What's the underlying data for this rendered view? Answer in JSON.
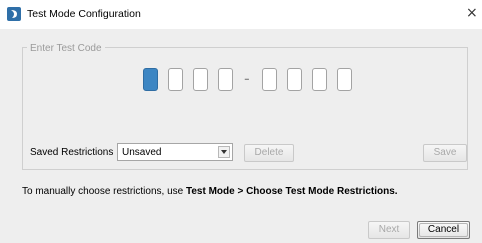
{
  "window": {
    "title": "Test Mode Configuration",
    "close_symbol": "×",
    "icon": "app-icon"
  },
  "code_group": {
    "legend": "Enter Test Code",
    "separator": "-",
    "box_count": 8,
    "active_index": 0
  },
  "restrictions": {
    "label": "Saved Restrictions",
    "selected": "Unsaved",
    "delete_label": "Delete",
    "save_label": "Save"
  },
  "instruction": {
    "prefix": "To manually choose restrictions, use ",
    "bold": "Test Mode > Choose Test Mode Restrictions."
  },
  "footer": {
    "next_label": "Next",
    "cancel_label": "Cancel"
  },
  "colors": {
    "accent": "#3d86c3",
    "dialog_bg": "#eeeeee"
  }
}
